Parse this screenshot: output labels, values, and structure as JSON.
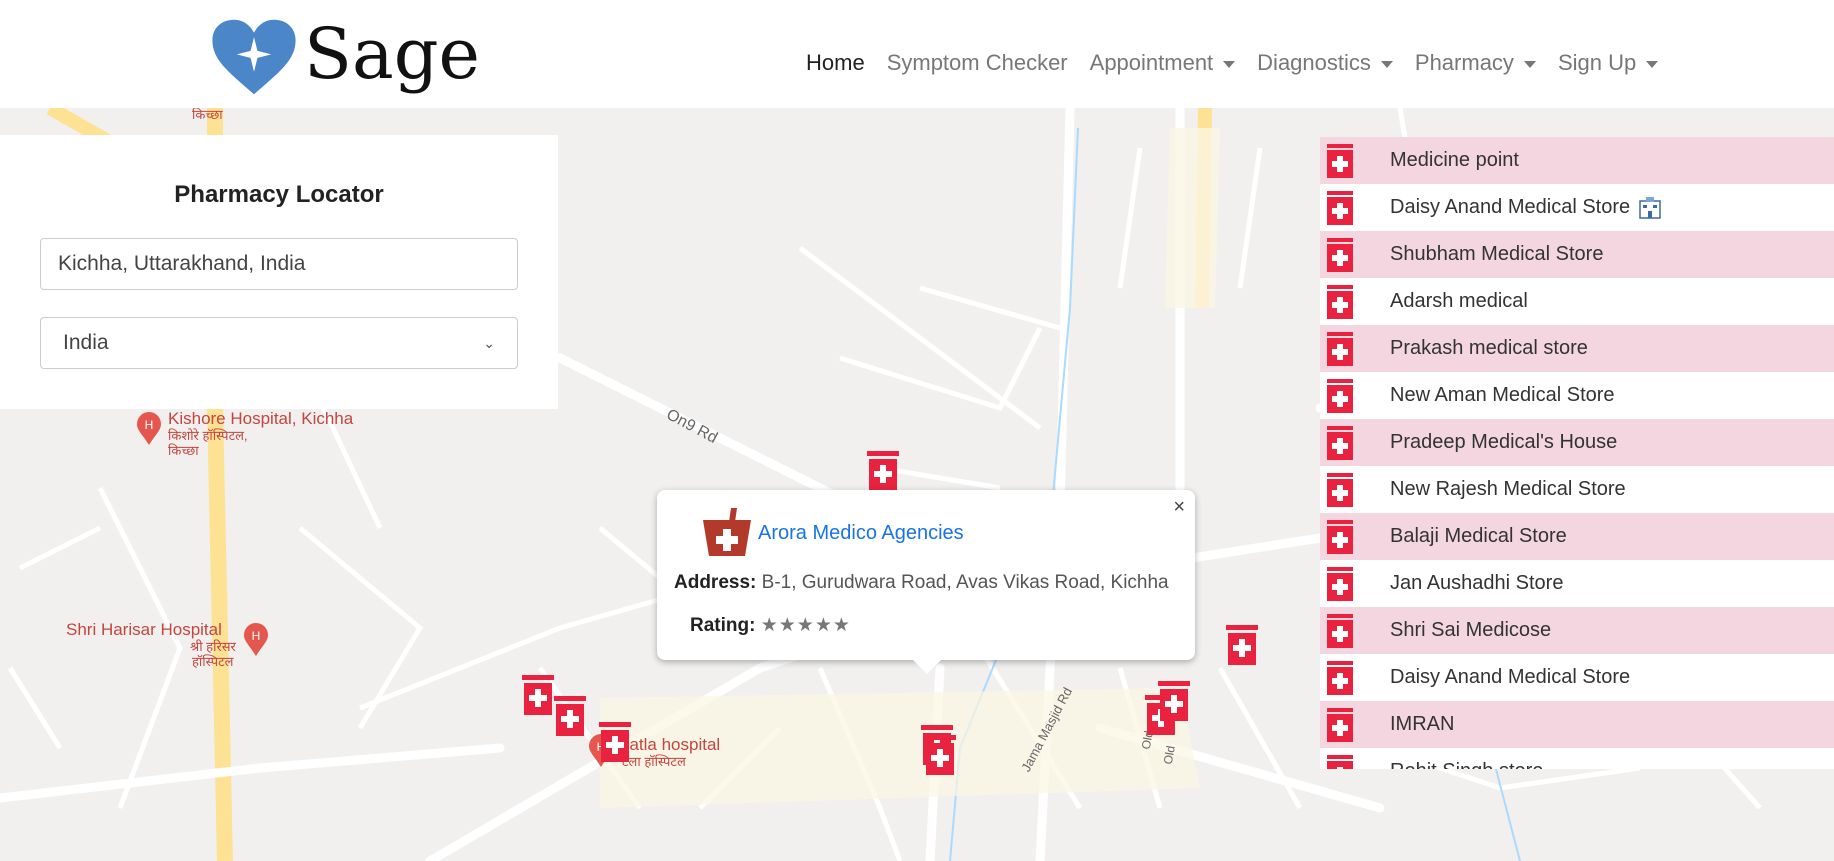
{
  "brand": {
    "name": "Sage",
    "colors": {
      "heart": "#4a86c8",
      "accent": "#e8223f",
      "link": "#1a73e8",
      "row_alt": "#f3d6df"
    }
  },
  "nav": {
    "home": "Home",
    "symptom_checker": "Symptom Checker",
    "appointment": "Appointment",
    "diagnostics": "Diagnostics",
    "pharmacy": "Pharmacy",
    "sign_up": "Sign Up"
  },
  "locator": {
    "title": "Pharmacy Locator",
    "location_value": "Kichha, Uttarakhand, India",
    "country_selected": "India"
  },
  "popup": {
    "name": "Arora Medico Agencies",
    "address_label": "Address:",
    "address": "B-1, Gurudwara Road, Avas Vikas Road, Kichha",
    "rating_label": "Rating:",
    "rating_stars": "★★★★★",
    "close": "×"
  },
  "pharmacies": [
    "Medicine point",
    "Daisy Anand Medical Store",
    "Shubham Medical Store",
    "Adarsh medical",
    "Prakash medical store",
    "New Aman Medical Store",
    "Pradeep Medical's House",
    "New Rajesh Medical Store",
    "Balaji Medical Store",
    "Jan Aushadhi Store",
    "Shri Sai Medicose",
    "Daisy Anand Medical Store",
    "IMRAN",
    "Rohit Singh store"
  ],
  "map_labels": {
    "kishore": "Kishore Hospital, Kichha",
    "kishore_hi1": "किशोरे हॉस्पिटल,",
    "kishore_hi2": "किच्छा",
    "harisar": "Shri Harisar Hospital",
    "harisar_hi1": "श्री हरिसर",
    "harisar_hi2": "हॉस्पिटल",
    "bhatla": "hatla hospital",
    "bhatla_hi": "टला हॉस्पिटल",
    "kichha_top": "किच्छा",
    "on9": "On9 Rd",
    "jama": "Jama Masjid Rd",
    "old1": "Old",
    "old2": "Old"
  }
}
